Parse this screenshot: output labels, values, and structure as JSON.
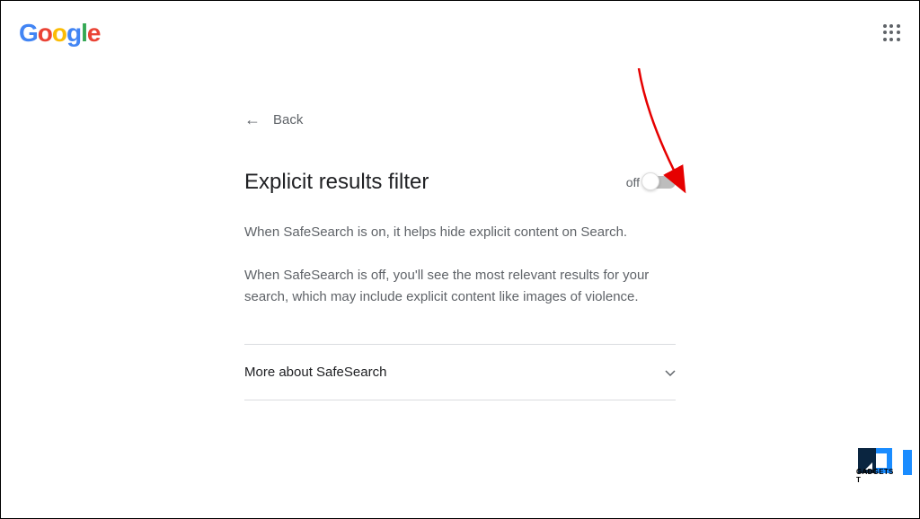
{
  "header": {
    "logo_text": "Google"
  },
  "back": {
    "label": "Back"
  },
  "page": {
    "title": "Explicit results filter",
    "toggle_state": "off",
    "description_on": "When SafeSearch is on, it helps hide explicit content on Search.",
    "description_off": "When SafeSearch is off, you'll see the most relevant results for your search, which may include explicit content like images of violence."
  },
  "expandable": {
    "title": "More about SafeSearch"
  },
  "watermark": {
    "text": "GADGETS T"
  }
}
